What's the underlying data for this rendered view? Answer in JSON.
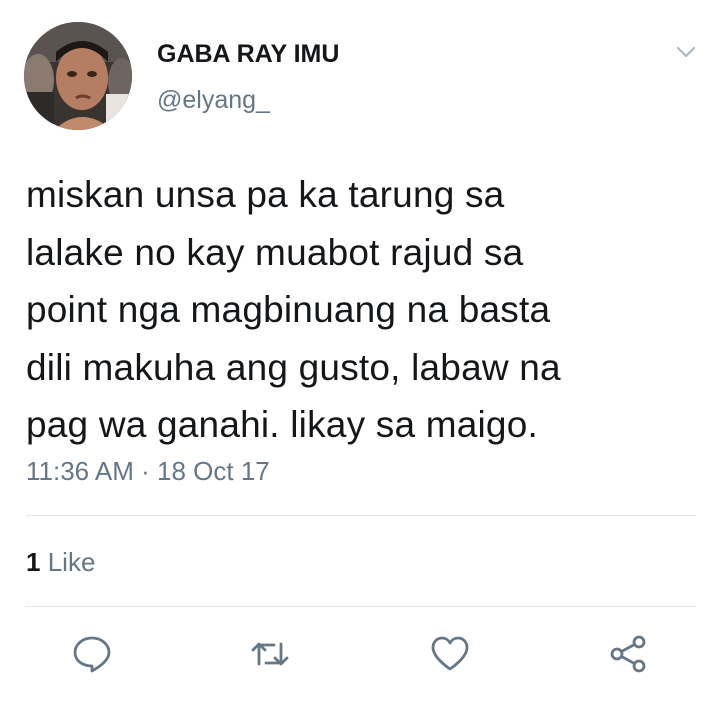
{
  "author": {
    "display_name": "GABA RAY IMU",
    "handle": "@elyang_",
    "avatar_icon": "profile-photo"
  },
  "tweet": {
    "lines": [
      "miskan unsa pa ka tarung sa",
      "lalake no kay muabot rajud sa",
      "point nga magbinuang na basta",
      "dili makuha ang gusto, labaw na",
      "pag wa ganahi. likay sa maigo."
    ],
    "timestamp": "11:36 AM · 18 Oct 17"
  },
  "stats": {
    "like_count": "1",
    "like_label": "Like"
  },
  "actions": {
    "reply_icon": "reply-icon",
    "retweet_icon": "retweet-icon",
    "like_icon": "heart-icon",
    "share_icon": "share-icon",
    "menu_icon": "chevron-down-icon"
  },
  "colors": {
    "text": "#14171a",
    "secondary": "#657786",
    "divider": "#e1e8ed",
    "icon": "#657786"
  }
}
